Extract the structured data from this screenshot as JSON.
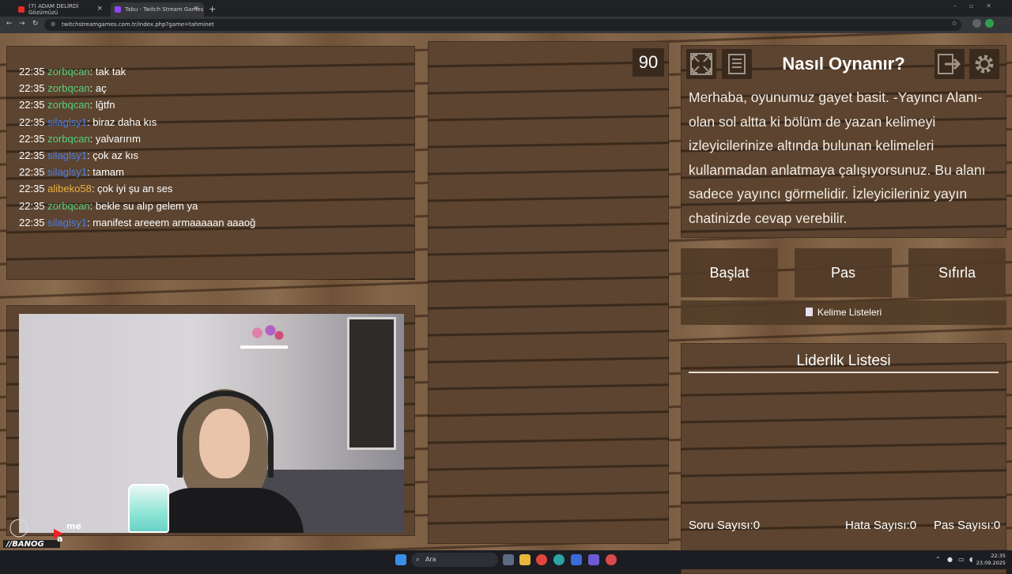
{
  "browser": {
    "tabs": [
      {
        "title": "(7) ADAM DELİRDİ Gözümüzü",
        "favicon_color": "#e52d27"
      },
      {
        "title": "Tabu - Twitch Stream Games",
        "favicon_color": "#9146ff"
      }
    ],
    "new_tab": "+",
    "close": "×",
    "url": "twitchstreamgames.com.tr/index.php?game=tahminet"
  },
  "chat": {
    "messages": [
      {
        "time": "22:35",
        "user": "zorbqcan",
        "color": "green",
        "text": ": tak tak"
      },
      {
        "time": "22:35",
        "user": "zorbqcan",
        "color": "green",
        "text": ": aç"
      },
      {
        "time": "22:35",
        "user": "zorbqcan",
        "color": "green",
        "text": ": lğtfn"
      },
      {
        "time": "22:35",
        "user": "silaglsy1",
        "color": "blue",
        "text": ": biraz daha kıs"
      },
      {
        "time": "22:35",
        "user": "zorbqcan",
        "color": "green",
        "text": ": yalvarırım"
      },
      {
        "time": "22:35",
        "user": "silaglsy1",
        "color": "blue",
        "text": ": çok az kıs"
      },
      {
        "time": "22:35",
        "user": "silaglsy1",
        "color": "blue",
        "text": ": tamam"
      },
      {
        "time": "22:35",
        "user": "alibeko58",
        "color": "orange",
        "text": ": çok iyi şu an ses"
      },
      {
        "time": "22:35",
        "user": "zorbqcan",
        "color": "green",
        "text": ": bekle su alıp gelem ya"
      },
      {
        "time": "22:35",
        "user": "silaglsy1",
        "color": "blue",
        "text": ": manifest areeem armaaaaan aaaoğ"
      }
    ]
  },
  "timer": "90",
  "howto": {
    "title": "Nasıl Oynanır?",
    "text": "Merhaba, oyunumuz gayet basit. -Yayıncı Alanı- olan sol altta ki bölüm de yazan kelimeyi izleyicilerinize altında bulunan kelimeleri kullanmadan anlatmaya çalışıyorsunuz. Bu alanı sadece yayıncı görmelidir. İzleyicileriniz yayın chatinizde cevap verebilir."
  },
  "actions": {
    "start": "Başlat",
    "pass": "Pas",
    "reset": "Sıfırla"
  },
  "word_lists": "Kelime Listeleri",
  "leaderboard": {
    "title": "Liderlik Listesi",
    "questions": "Soru Sayısı:0",
    "errors": "Hata Sayısı:0",
    "passes": "Pas Sayısı:0"
  },
  "taskbar": {
    "search_placeholder": "Ara",
    "time": "22:35",
    "date": "23.09.2025"
  },
  "colors": {
    "chat_green": "#57d07c",
    "chat_blue": "#4a7fe8",
    "chat_orange": "#f0b249"
  }
}
